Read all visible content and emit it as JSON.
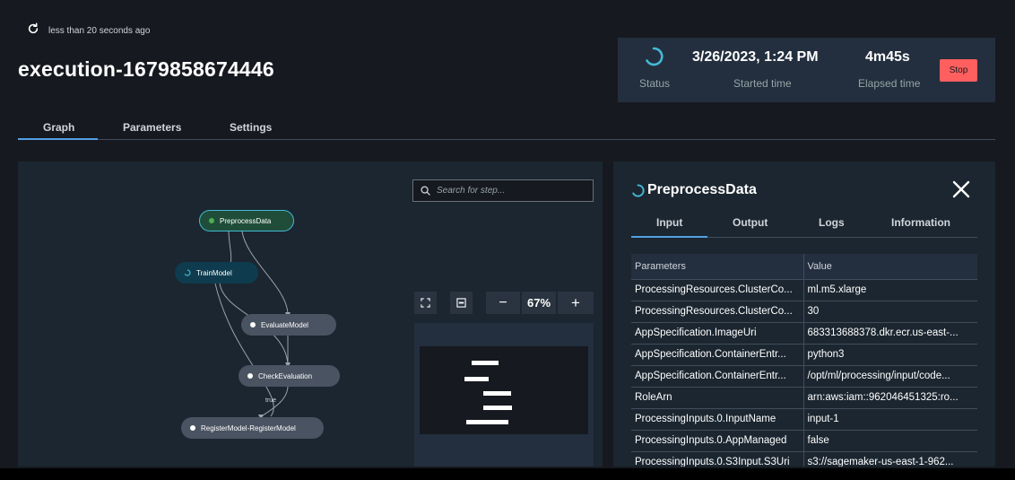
{
  "header": {
    "refresh_text": "less than 20 seconds ago",
    "title": "execution-1679858674446"
  },
  "status": {
    "status_label": "Status",
    "started_time": "3/26/2023, 1:24 PM",
    "started_label": "Started time",
    "elapsed_time": "4m45s",
    "elapsed_label": "Elapsed time",
    "stop_label": "Stop"
  },
  "tabs": [
    {
      "label": "Graph",
      "active": true
    },
    {
      "label": "Parameters",
      "active": false
    },
    {
      "label": "Settings",
      "active": false
    }
  ],
  "graph": {
    "search_placeholder": "Search for step...",
    "zoom": "67%",
    "zoom_out": "−",
    "zoom_in": "+",
    "edge_label": "true",
    "nodes": [
      {
        "label": "PreprocessData",
        "status": "running-selected"
      },
      {
        "label": "TrainModel",
        "status": "running"
      },
      {
        "label": "EvaluateModel",
        "status": "pending"
      },
      {
        "label": "CheckEvaluation",
        "status": "pending"
      },
      {
        "label": "RegisterModel-RegisterModel",
        "status": "pending"
      }
    ]
  },
  "details": {
    "title": "PreprocessData",
    "tabs": [
      {
        "label": "Input",
        "active": true
      },
      {
        "label": "Output",
        "active": false
      },
      {
        "label": "Logs",
        "active": false
      },
      {
        "label": "Information",
        "active": false
      }
    ],
    "columns": [
      "Parameters",
      "Value"
    ],
    "rows": [
      [
        "ProcessingResources.ClusterCo...",
        "ml.m5.xlarge"
      ],
      [
        "ProcessingResources.ClusterCo...",
        "30"
      ],
      [
        "AppSpecification.ImageUri",
        "683313688378.dkr.ecr.us-east-..."
      ],
      [
        "AppSpecification.ContainerEntr...",
        "python3"
      ],
      [
        "AppSpecification.ContainerEntr...",
        "/opt/ml/processing/input/code..."
      ],
      [
        "RoleArn",
        "arn:aws:iam::962046451325:ro..."
      ],
      [
        "ProcessingInputs.0.InputName",
        "input-1"
      ],
      [
        "ProcessingInputs.0.AppManaged",
        "false"
      ],
      [
        "ProcessingInputs.0.S3Input.S3Uri",
        "s3://sagemaker-us-east-1-962..."
      ]
    ]
  },
  "colors": {
    "accent": "#539fe5",
    "stop": "#ff5f5f",
    "running": "#44b9d6",
    "success_dot": "#4caf50"
  }
}
